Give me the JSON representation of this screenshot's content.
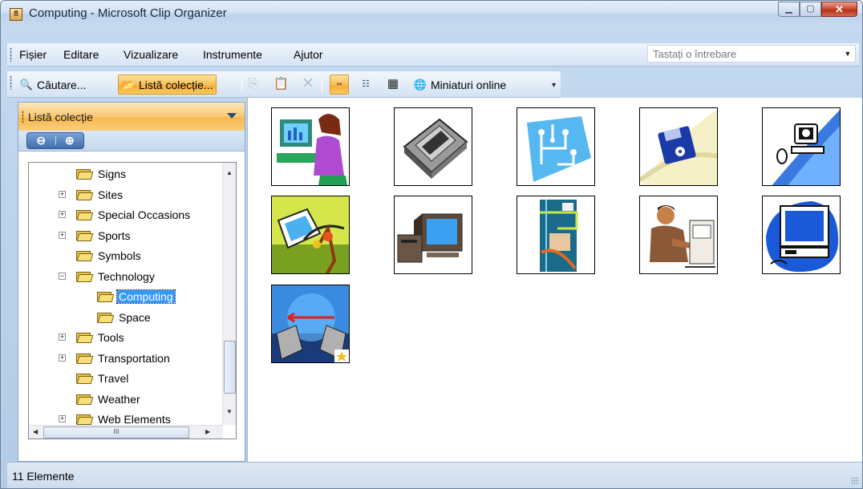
{
  "window": {
    "title": "Computing - Microsoft Clip Organizer"
  },
  "menubar": {
    "items": [
      {
        "label": "Fișier"
      },
      {
        "label": "Editare"
      },
      {
        "label": "Vizualizare"
      },
      {
        "label": "Instrumente"
      },
      {
        "label": "Ajutor"
      }
    ],
    "ask_placeholder": "Tastați o întrebare"
  },
  "toolbar": {
    "search_label": "Căutare...",
    "collection_list_label": "Listă colecție...",
    "online_label": "Miniaturi online"
  },
  "taskpane": {
    "title": "Listă colecție",
    "tree": [
      {
        "label": "Signs",
        "expandable": false
      },
      {
        "label": "Sites",
        "expandable": true
      },
      {
        "label": "Special Occasions",
        "expandable": true
      },
      {
        "label": "Sports",
        "expandable": true
      },
      {
        "label": "Symbols",
        "expandable": false
      },
      {
        "label": "Technology",
        "expandable": true,
        "expanded": true
      },
      {
        "label": "Computing",
        "selected": true
      },
      {
        "label": "Space"
      },
      {
        "label": "Tools",
        "expandable": true
      },
      {
        "label": "Transportation",
        "expandable": true
      },
      {
        "label": "Travel",
        "expandable": false
      },
      {
        "label": "Weather",
        "expandable": false
      },
      {
        "label": "Web Elements",
        "expandable": true
      }
    ]
  },
  "clips": [
    {
      "icon": "woman-at-computer"
    },
    {
      "icon": "disk-drive"
    },
    {
      "icon": "circuit-diamond"
    },
    {
      "icon": "floppy-disk"
    },
    {
      "icon": "monitor-mouse"
    },
    {
      "icon": "abstract-network"
    },
    {
      "icon": "crt-computer"
    },
    {
      "icon": "circuit-collage"
    },
    {
      "icon": "man-at-computer"
    },
    {
      "icon": "blue-computer"
    },
    {
      "icon": "laptops-exchange"
    }
  ],
  "status": {
    "text": "11 Elemente"
  },
  "colors": {
    "accent_orange": "#f7b94e",
    "frame_blue": "#c5daf0",
    "selection": "#3399ff"
  }
}
